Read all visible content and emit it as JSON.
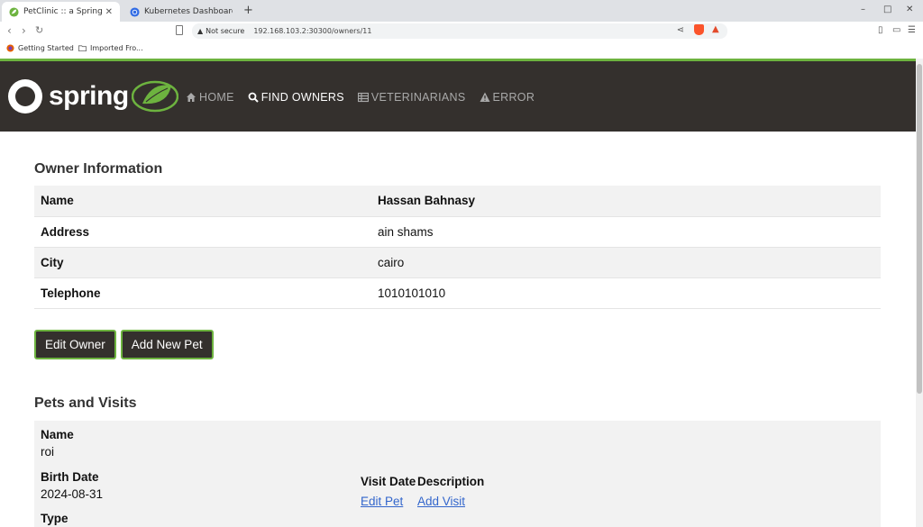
{
  "browser": {
    "tabs": [
      {
        "label": "PetClinic :: a Spring Fram",
        "active": true
      },
      {
        "label": "Kubernetes Dashboard",
        "active": false
      }
    ],
    "new_tab": "+",
    "window_controls": {
      "minimize": "–",
      "maximize": "□",
      "close": "✕"
    },
    "security": "Not secure",
    "url": "192.168.103.2:30300/owners/11",
    "bookmarks": [
      "Getting Started",
      "Imported Fro..."
    ]
  },
  "nav": {
    "logo_text": "spring",
    "items": [
      {
        "label": "HOME",
        "icon": "home-icon"
      },
      {
        "label": "FIND OWNERS",
        "icon": "search-icon"
      },
      {
        "label": "VETERINARIANS",
        "icon": "list-icon"
      },
      {
        "label": "ERROR",
        "icon": "warning-icon"
      }
    ],
    "active": "FIND OWNERS"
  },
  "owner": {
    "title": "Owner Information",
    "rows": [
      {
        "label": "Name",
        "value": "Hassan Bahnasy"
      },
      {
        "label": "Address",
        "value": "ain shams"
      },
      {
        "label": "City",
        "value": "cairo"
      },
      {
        "label": "Telephone",
        "value": "1010101010"
      }
    ],
    "buttons": {
      "edit": "Edit Owner",
      "add_pet": "Add New Pet"
    }
  },
  "pets": {
    "title": "Pets and Visits",
    "labels": {
      "name": "Name",
      "birth_date": "Birth Date",
      "type": "Type"
    },
    "items": [
      {
        "name": "roi",
        "birth_date": "2024-08-31"
      }
    ],
    "visit_headers": {
      "date": "Visit Date",
      "description": "Description"
    },
    "links": {
      "edit_pet": "Edit Pet",
      "add_visit": "Add Visit"
    }
  },
  "colors": {
    "nav_bg": "#34302d",
    "accent": "#6db33f",
    "link": "#3366cc"
  }
}
